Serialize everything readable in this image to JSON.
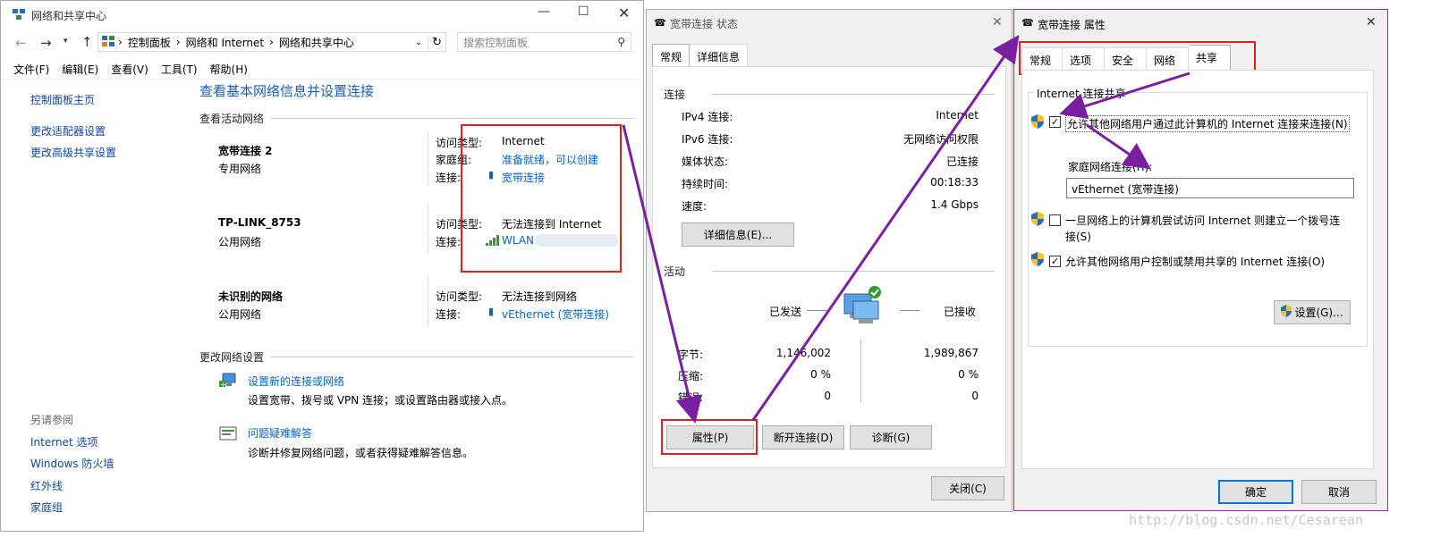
{
  "w1": {
    "title": "网络和共享中心",
    "breadcrumb": [
      "控制面板",
      "网络和 Internet",
      "网络和共享中心"
    ],
    "search_placeholder": "搜索控制面板",
    "menu": [
      "文件(F)",
      "编辑(E)",
      "查看(V)",
      "工具(T)",
      "帮助(H)"
    ],
    "side_links": [
      "控制面板主页",
      "更改适配器设置",
      "更改高级共享设置"
    ],
    "see_also_title": "另请参阅",
    "see_also": [
      "Internet 选项",
      "Windows 防火墙",
      "红外线",
      "家庭组"
    ],
    "heading": "查看基本网络信息并设置连接",
    "active_title": "查看活动网络",
    "networks": [
      {
        "name": "宽带连接  2",
        "type": "专用网络",
        "rows": [
          [
            "访问类型:",
            "Internet",
            false
          ],
          [
            "家庭组:",
            "准备就绪，可以创建",
            true
          ],
          [
            "连接:",
            "宽带连接",
            true
          ]
        ]
      },
      {
        "name": "TP-LINK_8753",
        "type": "公用网络",
        "rows": [
          [
            "访问类型:",
            "无法连接到 Internet",
            false
          ],
          [
            "连接:",
            "WLAN",
            true
          ]
        ]
      },
      {
        "name": "未识别的网络",
        "type": "公用网络",
        "rows": [
          [
            "访问类型:",
            "无法连接到网络",
            false
          ],
          [
            "连接:",
            "vEthernet (宽带连接)",
            true
          ]
        ]
      }
    ],
    "change_title": "更改网络设置",
    "tasks": [
      {
        "link": "设置新的连接或网络",
        "desc": "设置宽带、拨号或 VPN 连接；或设置路由器或接入点。"
      },
      {
        "link": "问题疑难解答",
        "desc": "诊断并修复网络问题，或者获得疑难解答信息。"
      }
    ]
  },
  "w2": {
    "title": "宽带连接 状态",
    "tabs": [
      "常规",
      "详细信息"
    ],
    "conn_title": "连接",
    "rows": [
      [
        "IPv4 连接:",
        "Internet"
      ],
      [
        "IPv6 连接:",
        "无网络访问权限"
      ],
      [
        "媒体状态:",
        "已连接"
      ],
      [
        "持续时间:",
        "00:18:33"
      ],
      [
        "速度:",
        "1.4 Gbps"
      ]
    ],
    "details_btn": "详细信息(E)...",
    "activity_title": "活动",
    "sent_label": "已发送",
    "recv_label": "已接收",
    "activity": [
      [
        "字节:",
        "1,146,002",
        "1,989,867"
      ],
      [
        "压缩:",
        "0 %",
        "0 %"
      ],
      [
        "错误:",
        "0",
        "0"
      ]
    ],
    "btns": [
      "属性(P)",
      "断开连接(D)",
      "诊断(G)"
    ],
    "close_btn": "关闭(C)"
  },
  "w3": {
    "title": "宽带连接 属性",
    "tabs": [
      "常规",
      "选项",
      "安全",
      "网络",
      "共享"
    ],
    "group_title": "Internet 连接共享",
    "opt1": "允许其他网络用户通过此计算机的 Internet 连接来连接(N)",
    "home_label": "家庭网络连接(H):",
    "home_value": "vEthernet (宽带连接)",
    "opt2_line1": "一旦网络上的计算机尝试访问 Internet 则建立一个拨号连",
    "opt2_line2": "接(S)",
    "opt3": "允许其他网络用户控制或禁用共享的 Internet 连接(O)",
    "settings_btn": "设置(G)...",
    "ok_btn": "确定",
    "cancel_btn": "取消"
  },
  "watermark": "http://blog.csdn.net/Cesarean",
  "colors": {
    "link": "#0066cc",
    "highlight": "#e02020",
    "arrow": "#7b1fa2",
    "accent_border": "#a020c0"
  }
}
